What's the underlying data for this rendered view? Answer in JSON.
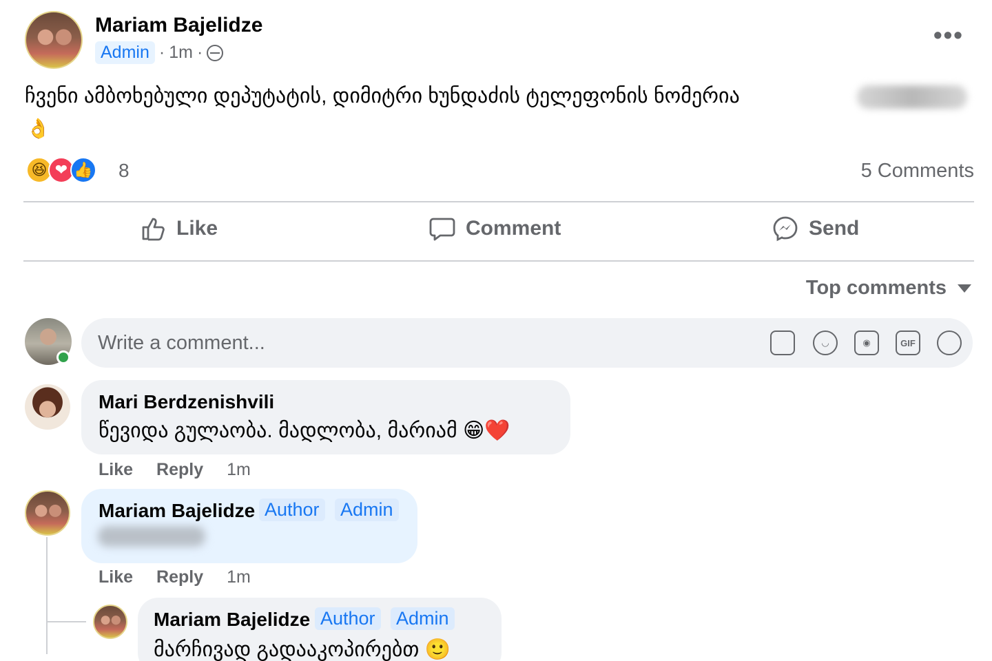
{
  "post": {
    "author": "Mariam Bajelidze",
    "badge": "Admin",
    "time": "1m",
    "separator": "·",
    "text": "ჩვენი ამბოხებული დეპუტატის, დიმიტრი ხუნდაძის ტელეფონის ნომერია",
    "emoji": "👌",
    "reaction_icons": [
      "haha-icon",
      "love-icon",
      "like-icon"
    ],
    "reaction_glyphs": [
      "😆",
      "❤",
      "👍"
    ],
    "reaction_count": "8",
    "comment_count": "5 Comments",
    "more_label": "•••"
  },
  "actions": {
    "like": "Like",
    "comment": "Comment",
    "send": "Send"
  },
  "sort": {
    "label": "Top comments"
  },
  "composer": {
    "placeholder": "Write a comment...",
    "gif": "GIF"
  },
  "comments": [
    {
      "author": "Mari Berdzenishvili",
      "text": "წევიდა გულაობა. მადლობა, მარიამ",
      "emoji": "😁❤️",
      "like": "Like",
      "reply": "Reply",
      "time": "1m"
    },
    {
      "author": "Mariam Bajelidze",
      "badge_author": "Author",
      "badge_admin": "Admin",
      "like": "Like",
      "reply": "Reply",
      "time": "1m"
    },
    {
      "author": "Mariam Bajelidze",
      "badge_author": "Author",
      "badge_admin": "Admin",
      "text": "მარჩივად გადააკოპირებთ",
      "emoji": "🙂"
    }
  ],
  "colors": {
    "accent": "#1877f2",
    "secondary_text": "#65676b",
    "bubble": "#f0f2f5",
    "author_bubble": "#e7f3ff",
    "online": "#31a24c"
  }
}
